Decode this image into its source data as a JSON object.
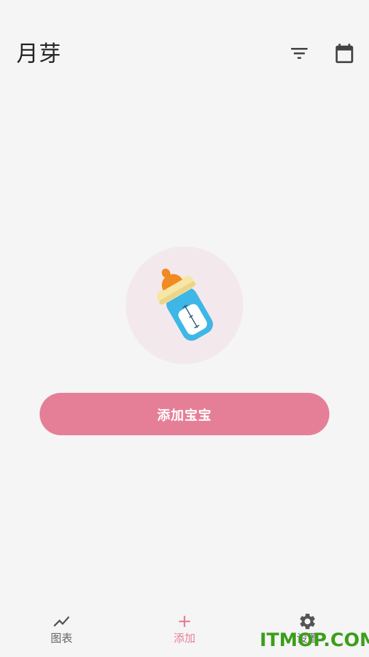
{
  "header": {
    "title": "月芽",
    "filter_icon": "filter-icon",
    "calendar_icon": "calendar-icon"
  },
  "empty_state": {
    "illustration_icon": "baby-bottle-icon",
    "add_baby_label": "添加宝宝"
  },
  "bottom_nav": {
    "items": [
      {
        "label": "图表",
        "icon": "trending-chart-icon",
        "active": false
      },
      {
        "label": "添加",
        "icon": "plus-icon",
        "active": true
      },
      {
        "label": "设置",
        "icon": "gear-icon",
        "active": false
      }
    ]
  },
  "watermark": {
    "text": "ITMOP.COM"
  },
  "colors": {
    "accent": "#e57f98",
    "background": "#f5f5f5",
    "illustration_bg": "#f3e9ec",
    "watermark": "#3c9e1c",
    "icon_dark": "#424242",
    "nav_inactive": "#666666"
  }
}
